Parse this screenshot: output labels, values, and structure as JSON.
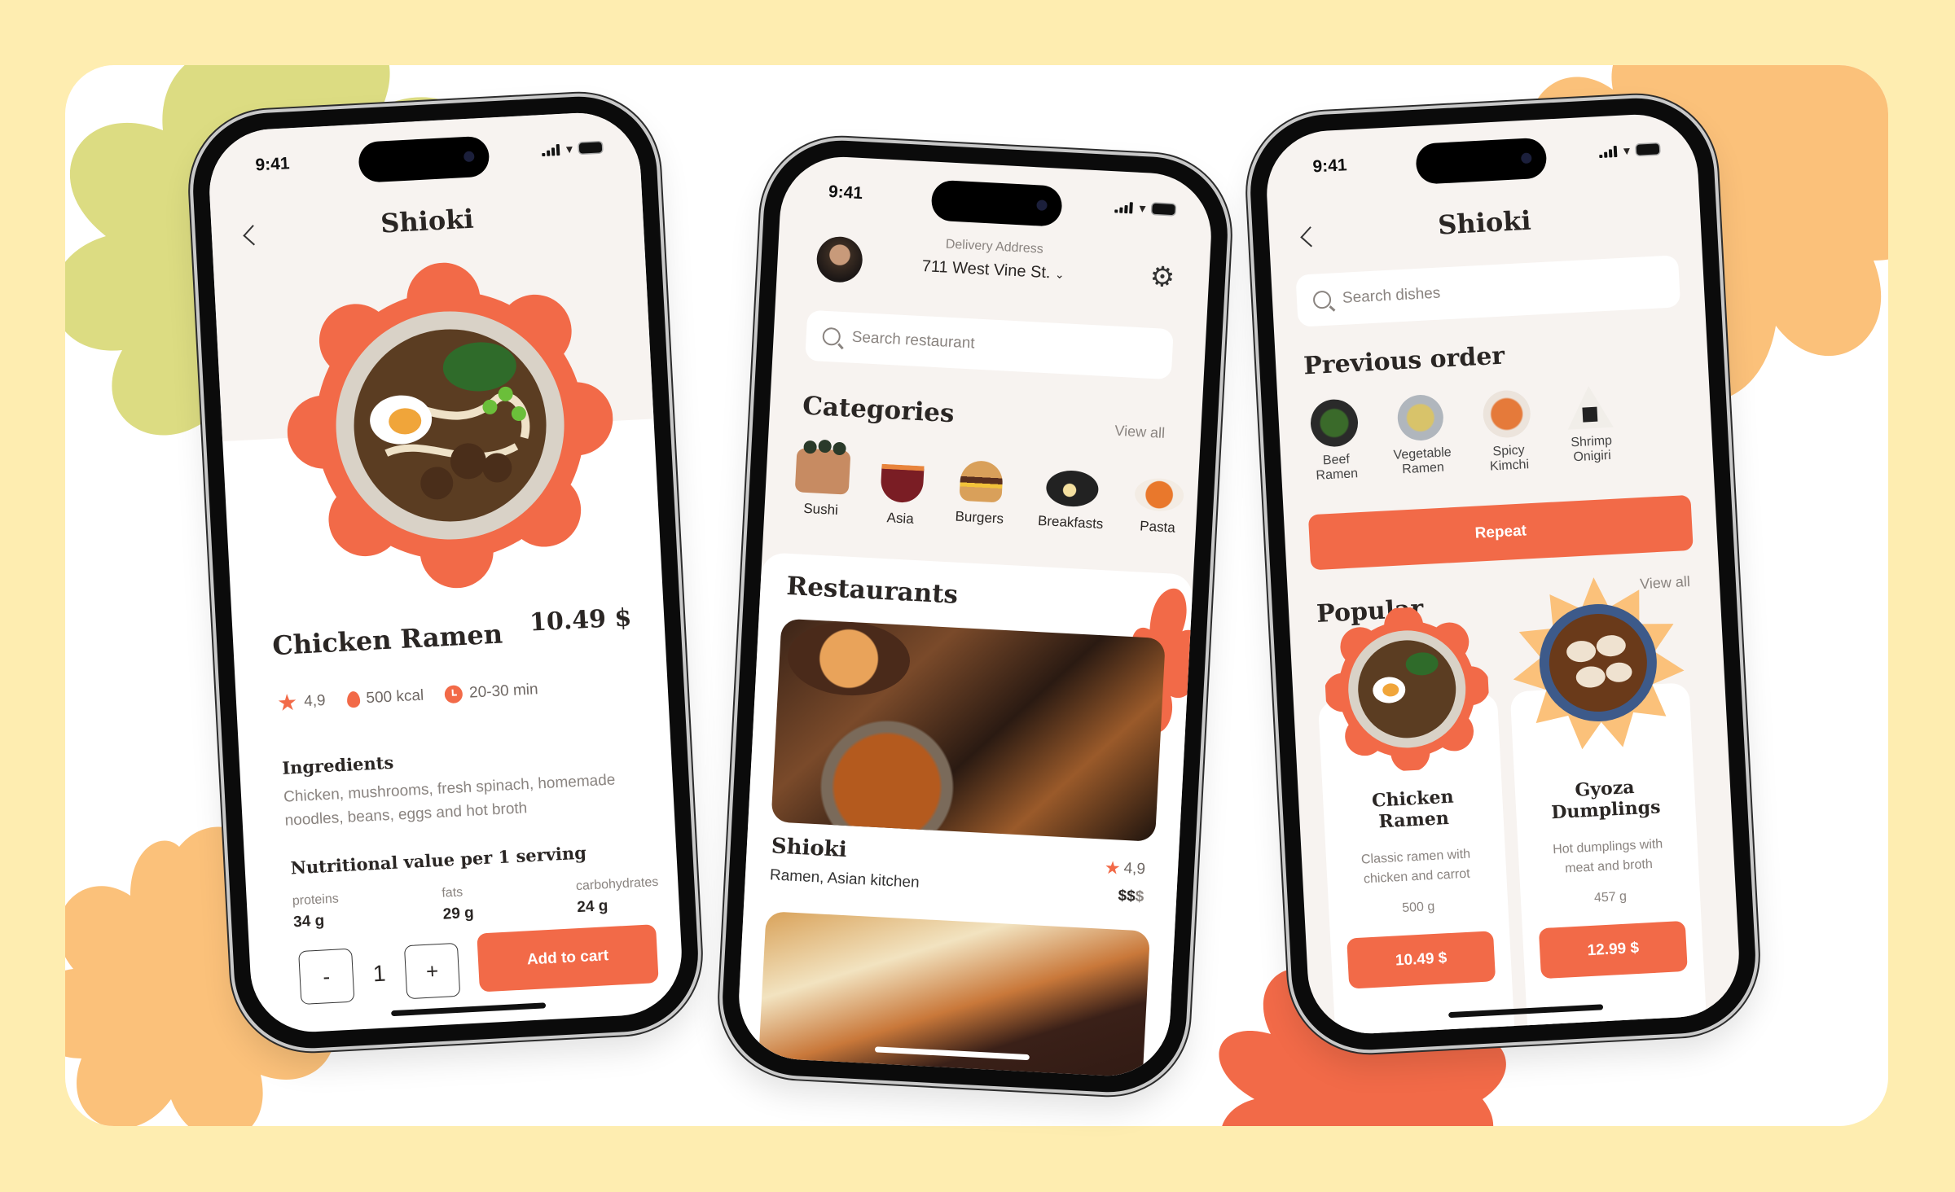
{
  "colors": {
    "page_background": "#FEEDB0",
    "card_background": "#FFFFFF",
    "accent": "#F26A48",
    "accent_light": "#FBC17A",
    "leaf_green": "#DCDC82",
    "screen_background": "#F7F3F0",
    "text_dark": "#2A2624",
    "text_muted": "#8A8480"
  },
  "status_bar": {
    "time": "9:41"
  },
  "detail_screen": {
    "app_title": "Shioki",
    "dish_name": "Chicken Ramen",
    "price": "10.49 $",
    "rating": "4,9",
    "calories": "500 kcal",
    "cook_time": "20-30 min",
    "ingredients_heading": "Ingredients",
    "ingredients_text": "Chicken, mushrooms, fresh spinach, homemade noodles, beans, eggs and hot broth",
    "nutrition_heading": "Nutritional value per 1 serving",
    "nutrition": [
      {
        "label": "proteins",
        "value": "34 g"
      },
      {
        "label": "fats",
        "value": "29 g"
      },
      {
        "label": "carbohydrates",
        "value": "24 g"
      }
    ],
    "quantity": "1",
    "decrement_label": "-",
    "increment_label": "+",
    "add_to_cart_label": "Add to cart"
  },
  "home_screen": {
    "delivery_label": "Delivery Address",
    "address": "711 West Vine St.",
    "search_placeholder": "Search restaurant",
    "categories_heading": "Categories",
    "view_all_label": "View all",
    "categories": [
      {
        "label": "Sushi",
        "icon": "sushi-icon"
      },
      {
        "label": "Asia",
        "icon": "noodle-bowl-icon"
      },
      {
        "label": "Burgers",
        "icon": "burger-icon"
      },
      {
        "label": "Breakfasts",
        "icon": "breakfast-plate-icon"
      },
      {
        "label": "Pasta",
        "icon": "pasta-icon"
      }
    ],
    "restaurants_heading": "Restaurants",
    "restaurants": [
      {
        "name": "Shioki",
        "cuisine": "Ramen, Asian kitchen",
        "rating": "4,9",
        "price_level_active": "$$",
        "price_level_inactive": "$"
      }
    ]
  },
  "menu_screen": {
    "app_title": "Shioki",
    "search_placeholder": "Search dishes",
    "previous_order_heading": "Previous order",
    "previous_order_items": [
      {
        "line1": "Beef",
        "line2": "Ramen"
      },
      {
        "line1": "Vegetable",
        "line2": "Ramen"
      },
      {
        "line1": "Spicy",
        "line2": "Kimchi"
      },
      {
        "line1": "Shrimp",
        "line2": "Onigiri"
      }
    ],
    "repeat_label": "Repeat",
    "popular_heading": "Popular",
    "view_all_label": "View all",
    "popular_items": [
      {
        "name_line1": "Chicken",
        "name_line2": "Ramen",
        "desc_line1": "Classic ramen with",
        "desc_line2": "chicken and carrot",
        "weight": "500 g",
        "price": "10.49 $"
      },
      {
        "name_line1": "Gyoza",
        "name_line2": "Dumplings",
        "desc_line1": "Hot dumplings with",
        "desc_line2": "meat and broth",
        "weight": "457 g",
        "price": "12.99 $"
      }
    ]
  }
}
